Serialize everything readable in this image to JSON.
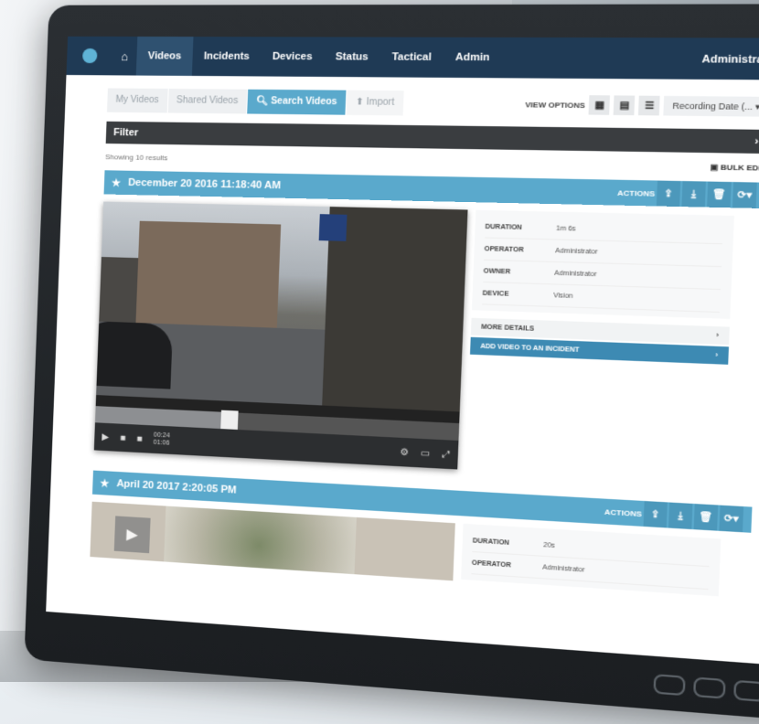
{
  "nav": {
    "items": [
      "Videos",
      "Incidents",
      "Devices",
      "Status",
      "Tactical",
      "Admin"
    ],
    "active": "Videos",
    "user": "Administrator"
  },
  "tabs": [
    "My Videos",
    "Shared Videos",
    "Search Videos",
    "Import"
  ],
  "active_tab": "Search Videos",
  "view_options": {
    "label": "VIEW OPTIONS",
    "sort": "Recording Date (..."
  },
  "filter": {
    "label": "Filter"
  },
  "results": {
    "text": "Showing 10 results",
    "bulk_edit": "BULK EDIT"
  },
  "records": [
    {
      "date": "December 20 2016 11:18:40 AM",
      "actions_label": "ACTIONS",
      "time_current": "00:24",
      "time_total": "01:06",
      "fields": [
        {
          "label": "DURATION",
          "value": "1m 6s"
        },
        {
          "label": "OPERATOR",
          "value": "Administrator"
        },
        {
          "label": "OWNER",
          "value": "Administrator"
        },
        {
          "label": "DEVICE",
          "value": "Vision"
        }
      ],
      "more_details": "MORE DETAILS",
      "add_incident": "ADD VIDEO TO AN INCIDENT"
    },
    {
      "date": "April 20 2017 2:20:05 PM",
      "actions_label": "ACTIONS",
      "fields": [
        {
          "label": "DURATION",
          "value": "20s"
        },
        {
          "label": "OPERATOR",
          "value": "Administrator"
        }
      ]
    }
  ],
  "colors": {
    "nav": "#1f3a55",
    "accent": "#5aa9cc",
    "filter_bar": "#3a3d40"
  },
  "playback": {
    "progress": 0.38
  }
}
